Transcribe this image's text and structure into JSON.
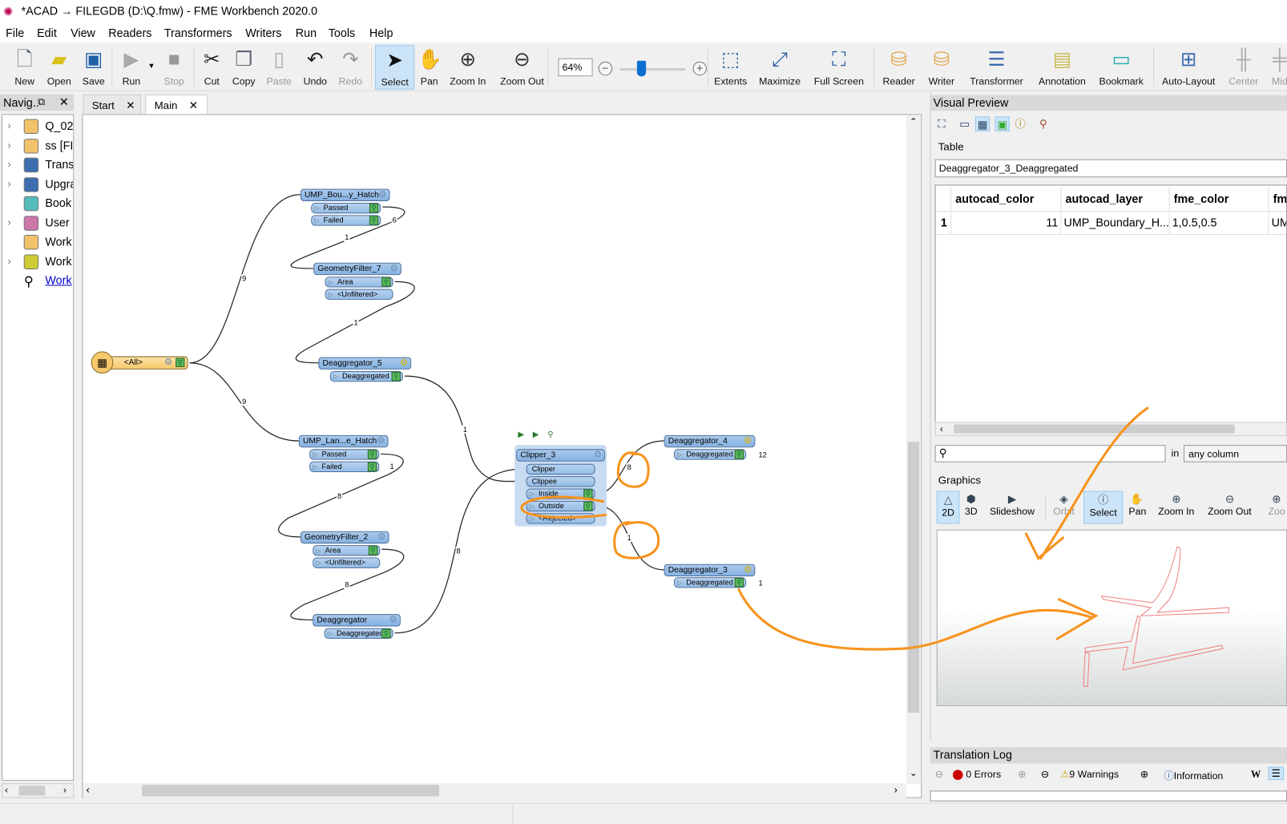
{
  "window": {
    "title": "*ACAD → FILEGDB (D:\\Q.fmw) - FME Workbench 2020.0"
  },
  "menu": [
    "File",
    "Edit",
    "View",
    "Readers",
    "Transformers",
    "Writers",
    "Run",
    "Tools",
    "Help"
  ],
  "toolbar": {
    "buttons": [
      {
        "label": "New",
        "icon": "new-file-icon",
        "state": "enabled"
      },
      {
        "label": "Open",
        "icon": "folder-open-icon",
        "state": "enabled"
      },
      {
        "label": "Save",
        "icon": "floppy-save-icon",
        "state": "enabled"
      },
      {
        "label": "Run",
        "icon": "play-icon",
        "state": "enabled"
      },
      {
        "label": "Stop",
        "icon": "stop-icon",
        "state": "disabled"
      },
      {
        "label": "Cut",
        "icon": "scissors-icon",
        "state": "enabled"
      },
      {
        "label": "Copy",
        "icon": "copy-icon",
        "state": "enabled"
      },
      {
        "label": "Paste",
        "icon": "clipboard-icon",
        "state": "disabled"
      },
      {
        "label": "Undo",
        "icon": "undo-icon",
        "state": "enabled"
      },
      {
        "label": "Redo",
        "icon": "redo-icon",
        "state": "disabled"
      },
      {
        "label": "Select",
        "icon": "cursor-arrow-icon",
        "state": "active"
      },
      {
        "label": "Pan",
        "icon": "hand-icon",
        "state": "enabled"
      },
      {
        "label": "Zoom In",
        "icon": "zoom-in-icon",
        "state": "enabled"
      },
      {
        "label": "Zoom Out",
        "icon": "zoom-out-icon",
        "state": "enabled"
      },
      {
        "label": "Extents",
        "icon": "extents-icon",
        "state": "enabled"
      },
      {
        "label": "Maximize",
        "icon": "maximize-icon",
        "state": "enabled"
      },
      {
        "label": "Full Screen",
        "icon": "full-screen-icon",
        "state": "enabled"
      },
      {
        "label": "Reader",
        "icon": "add-reader-icon",
        "state": "enabled"
      },
      {
        "label": "Writer",
        "icon": "add-writer-icon",
        "state": "enabled"
      },
      {
        "label": "Transformer",
        "icon": "add-transformer-icon",
        "state": "enabled"
      },
      {
        "label": "Annotation",
        "icon": "add-annotation-icon",
        "state": "enabled"
      },
      {
        "label": "Bookmark",
        "icon": "add-bookmark-icon",
        "state": "enabled"
      },
      {
        "label": "Auto-Layout",
        "icon": "auto-layout-icon",
        "state": "enabled"
      },
      {
        "label": "Center",
        "icon": "align-center-icon",
        "state": "disabled"
      },
      {
        "label": "Mid",
        "icon": "align-middle-icon",
        "state": "disabled"
      }
    ],
    "zoom_level": "64%",
    "zoom_slider_percent": 64
  },
  "navigator": {
    "title": "Navig..",
    "items": [
      {
        "label": "Q_02",
        "icon": "reader-dataset-icon",
        "expandable": true
      },
      {
        "label": "ss [FIL",
        "icon": "writer-dataset-icon",
        "expandable": true
      },
      {
        "label": "Trans",
        "icon": "transformers-icon",
        "expandable": true
      },
      {
        "label": "Upgra",
        "icon": "upgradable-transformers-icon",
        "expandable": true
      },
      {
        "label": "Book",
        "icon": "bookmark-icon",
        "expandable": false
      },
      {
        "label": "User P",
        "icon": "user-parameters-icon",
        "expandable": true
      },
      {
        "label": "Work",
        "icon": "workspace-resources-icon",
        "expandable": false
      },
      {
        "label": "Work",
        "icon": "workspace-parameters-icon",
        "expandable": true
      },
      {
        "label": "Work",
        "icon": "search-icon",
        "expandable": false,
        "link": true
      }
    ]
  },
  "tabs": [
    {
      "label": "Start",
      "active": false
    },
    {
      "label": "Main",
      "active": true
    }
  ],
  "canvas": {
    "nodes": [
      {
        "id": "reader",
        "name": "<All>",
        "type": "feature-type"
      },
      {
        "id": "bou",
        "name": "UMP_Bou...y_Hatch",
        "ports": [
          "Passed",
          "Failed"
        ]
      },
      {
        "id": "gf7",
        "name": "GeometryFilter_7",
        "ports": [
          "Area",
          "<Unfiltered>"
        ]
      },
      {
        "id": "deag5",
        "name": "Deaggregator_5",
        "ports": [
          "Deaggregated"
        ]
      },
      {
        "id": "lan",
        "name": "UMP_Lan...e_Hatch",
        "ports": [
          "Passed",
          "Failed"
        ]
      },
      {
        "id": "gf2",
        "name": "GeometryFilter_2",
        "ports": [
          "Area",
          "<Unfiltered>"
        ]
      },
      {
        "id": "deag",
        "name": "Deaggregator",
        "ports": [
          "Deaggregated"
        ]
      },
      {
        "id": "clip",
        "name": "Clipper_3",
        "inputs": [
          "Clipper",
          "Clippee"
        ],
        "ports": [
          "Inside",
          "Outside",
          "<Rejected>"
        ]
      },
      {
        "id": "deag4",
        "name": "Deaggregator_4",
        "ports": [
          "Deaggregated"
        ]
      },
      {
        "id": "deag3",
        "name": "Deaggregator_3",
        "ports": [
          "Deaggregated"
        ]
      }
    ],
    "link_counts": {
      "reader_to_bou": "9",
      "reader_to_lan": "9",
      "bou_failed": "6",
      "bou_to_gf7": "1",
      "gf7_to_deag5": "1",
      "deag5_to_clip": "1",
      "lan_failed": "1",
      "lan_to_gf2": "8",
      "gf2_to_deag": "8",
      "deag_to_clip": "8",
      "inside_to_deag4": "8",
      "outside_to_deag3": "1",
      "deag4_out": "12",
      "deag3_out": "1"
    },
    "annotation_color": "#f7931e"
  },
  "visual_preview": {
    "title": "Visual Preview",
    "table_label": "Table",
    "selected_table": "Deaggregator_3_Deaggregated",
    "columns": [
      "autocad_color",
      "autocad_layer",
      "fme_color",
      "fm"
    ],
    "rows": [
      {
        "index": "1",
        "cells": [
          "11",
          "UMP_Boundary_H...",
          "1,0.5,0.5",
          "UM"
        ]
      }
    ],
    "search_placeholder": "",
    "in_label": "in",
    "column_filter": "any column",
    "graphics_label": "Graphics",
    "graphics_buttons": [
      {
        "label": "2D",
        "state": "active"
      },
      {
        "label": "3D",
        "state": "enabled"
      },
      {
        "label": "Slideshow",
        "state": "enabled"
      },
      {
        "label": "Orbit",
        "state": "disabled"
      },
      {
        "label": "Select",
        "state": "active"
      },
      {
        "label": "Pan",
        "state": "enabled"
      },
      {
        "label": "Zoom In",
        "state": "enabled"
      },
      {
        "label": "Zoom Out",
        "state": "enabled"
      },
      {
        "label": "Zoo",
        "state": "disabled"
      }
    ],
    "geometry_color": "#f08080"
  },
  "translation_log": {
    "title": "Translation Log",
    "errors": "0 Errors",
    "warnings": "9 Warnings",
    "information": "Information"
  }
}
